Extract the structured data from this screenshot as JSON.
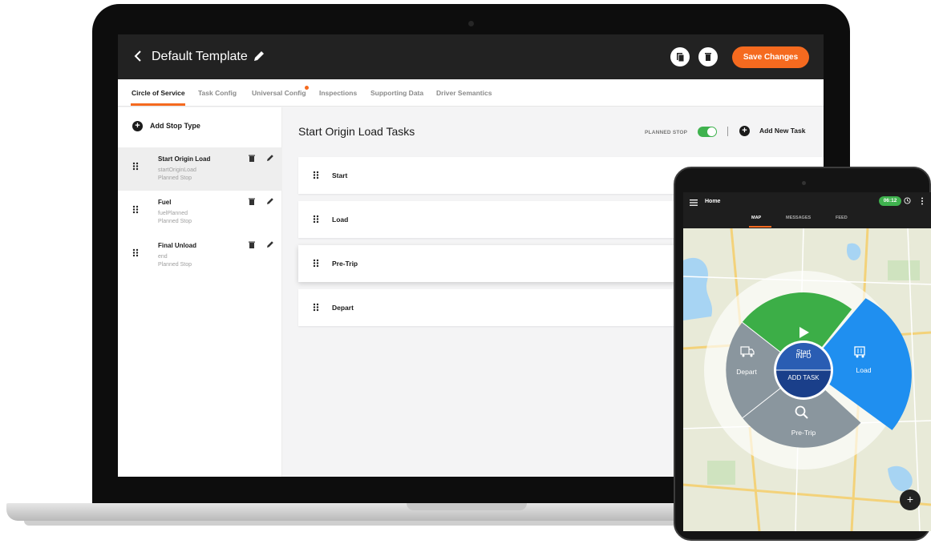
{
  "header": {
    "back_icon": "chevron-left-icon",
    "title": "Default Template",
    "edit_icon": "pencil-icon",
    "copy_icon": "copy-icon",
    "delete_icon": "trash-icon",
    "save_label": "Save Changes",
    "accent_color": "#f56a1f"
  },
  "tabs": [
    {
      "label": "Circle of Service",
      "active": true
    },
    {
      "label": "Task Config",
      "active": false
    },
    {
      "label": "Universal Config",
      "active": false,
      "badge": true
    },
    {
      "label": "Inspections",
      "active": false
    },
    {
      "label": "Supporting Data",
      "active": false
    },
    {
      "label": "Driver Semantics",
      "active": false
    }
  ],
  "sidebar": {
    "add_label": "Add Stop Type",
    "stops": [
      {
        "name": "Start Origin Load",
        "id": "startOriginLoad",
        "type": "Planned Stop",
        "selected": true
      },
      {
        "name": "Fuel",
        "id": "fuelPlanned",
        "type": "Planned Stop",
        "selected": false
      },
      {
        "name": "Final Unload",
        "id": "end",
        "type": "Planned Stop",
        "selected": false
      }
    ]
  },
  "main": {
    "title": "Start Origin Load Tasks",
    "planned_stop_label": "PLANNED STOP",
    "planned_stop_on": true,
    "add_task_label": "Add New Task",
    "tasks": [
      "Start",
      "Load",
      "Pre-Trip",
      "Depart"
    ]
  },
  "tablet": {
    "home_label": "Home",
    "time": "06:12",
    "tabs": [
      {
        "label": "MAP",
        "active": true
      },
      {
        "label": "MESSAGES",
        "active": false
      },
      {
        "label": "FEED",
        "active": false
      }
    ],
    "wheel": {
      "start": "Start",
      "load": "Load",
      "pretrip": "Pre-Trip",
      "depart": "Depart",
      "info": "INFO",
      "add_task": "ADD TASK"
    },
    "colors": {
      "start": "#3cae47",
      "load": "#1f8ff0",
      "pretrip": "#8a969e",
      "depart": "#8a969e",
      "center_top": "#2a5db3",
      "center_bottom": "#1a3f8a"
    },
    "fab_label": "+"
  }
}
